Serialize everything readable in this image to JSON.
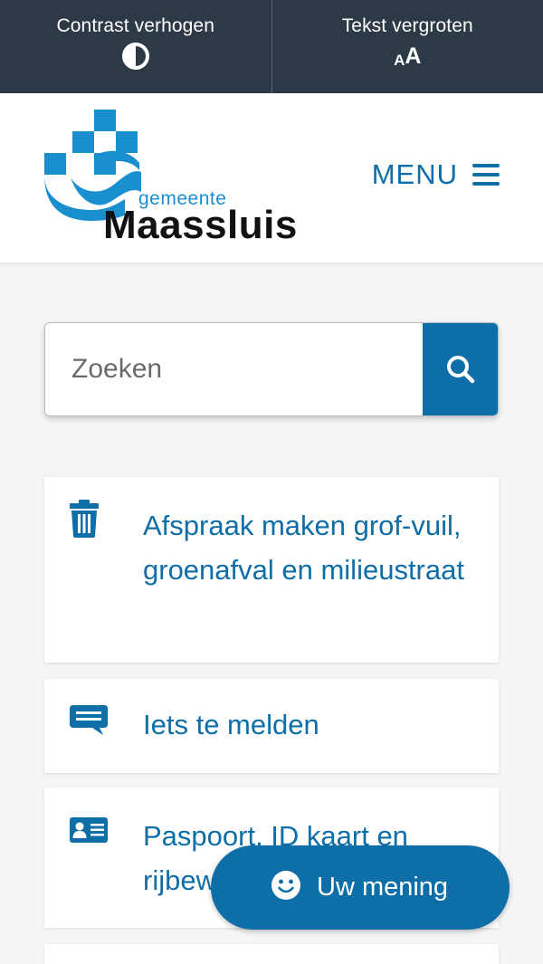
{
  "accessibility_bar": {
    "contrast_label": "Contrast verhogen",
    "text_size_label": "Tekst vergroten",
    "text_size_icon_small": "A",
    "text_size_icon_big": "A"
  },
  "header": {
    "logo": {
      "prefix": "gemeente",
      "name": "Maassluis"
    },
    "menu_label": "MENU"
  },
  "search": {
    "placeholder": "Zoeken",
    "value": ""
  },
  "cards": [
    {
      "icon": "trash-icon",
      "label": "Afspraak maken grof-vuil, groenafval en milieustraat"
    },
    {
      "icon": "chat-icon",
      "label": "Iets te melden"
    },
    {
      "icon": "id-card-icon",
      "label": "Paspoort, ID kaart en rijbewijs"
    }
  ],
  "feedback": {
    "label": "Uw mening",
    "icon": "smiley-icon"
  },
  "colors": {
    "topbar": "#2e3947",
    "accent": "#0d6ea8",
    "logo_blue": "#1a8fd0"
  }
}
